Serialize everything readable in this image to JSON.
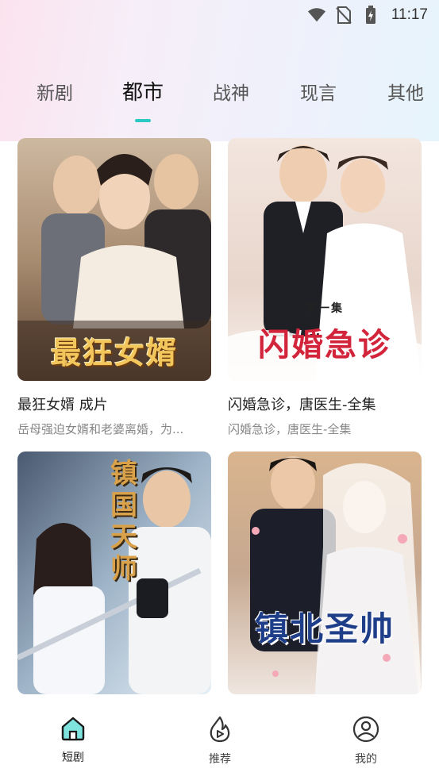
{
  "status_bar": {
    "time": "11:17"
  },
  "tabs": [
    {
      "label": "新剧",
      "active": false
    },
    {
      "label": "都市",
      "active": true
    },
    {
      "label": "战神",
      "active": false
    },
    {
      "label": "现言",
      "active": false
    },
    {
      "label": "其他",
      "active": false
    }
  ],
  "cards": [
    {
      "title": "最狂女婿 成片",
      "desc": "岳母强迫女婿和老婆离婚，为...",
      "poster_text": "最狂女婿",
      "poster_sub": ""
    },
    {
      "title": "闪婚急诊，唐医生-全集",
      "desc": "闪婚急诊，唐医生-全集",
      "poster_text": "闪婚急诊",
      "poster_sub": "第一集"
    },
    {
      "title": "",
      "desc": "",
      "poster_text": "镇国天师",
      "poster_sub": ""
    },
    {
      "title": "",
      "desc": "",
      "poster_text": "镇北圣帅",
      "poster_sub": ""
    }
  ],
  "bottom_nav": [
    {
      "label": "短剧",
      "icon": "home-icon",
      "active": true
    },
    {
      "label": "推荐",
      "icon": "flame-play-icon",
      "active": false
    },
    {
      "label": "我的",
      "icon": "profile-icon",
      "active": false
    }
  ],
  "colors": {
    "accent": "#2ec8c2"
  }
}
